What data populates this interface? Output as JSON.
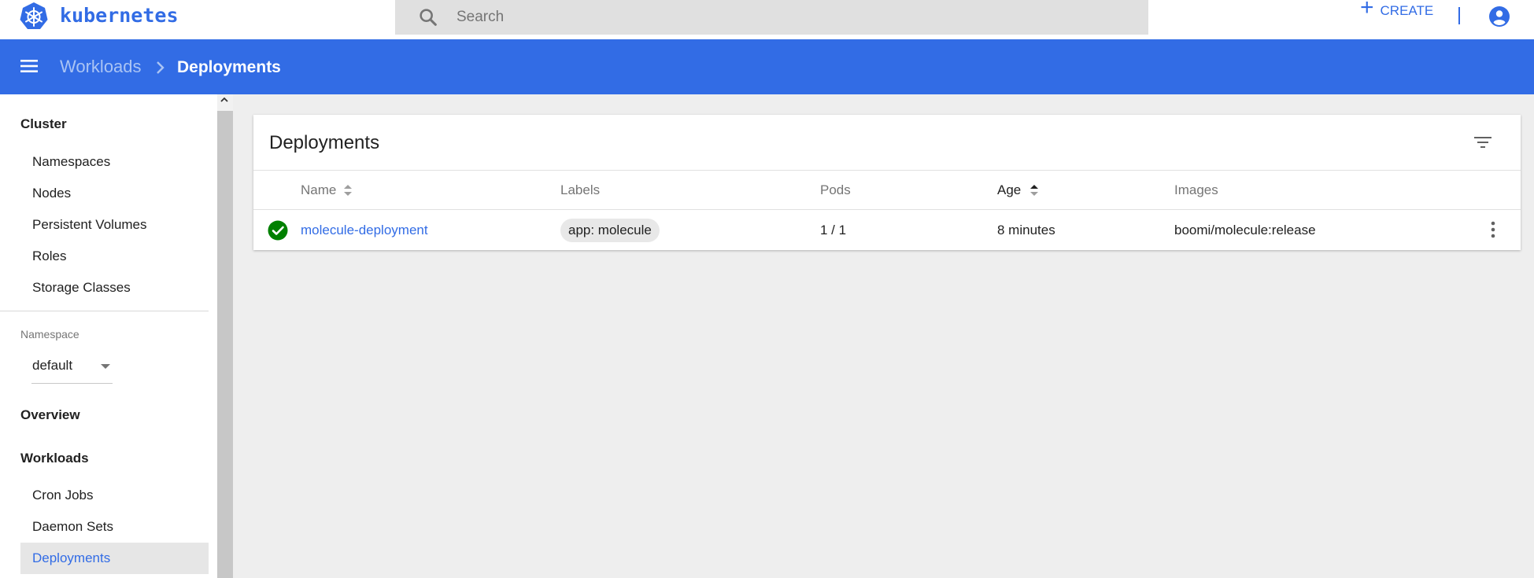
{
  "topbar": {
    "brand": "kubernetes",
    "search_placeholder": "Search",
    "create_label": "CREATE"
  },
  "header": {
    "breadcrumb_parent": "Workloads",
    "breadcrumb_current": "Deployments"
  },
  "sidebar": {
    "cluster_title": "Cluster",
    "cluster_items": [
      "Namespaces",
      "Nodes",
      "Persistent Volumes",
      "Roles",
      "Storage Classes"
    ],
    "namespace_label": "Namespace",
    "namespace_value": "default",
    "overview": "Overview",
    "workloads_title": "Workloads",
    "workload_items": [
      "Cron Jobs",
      "Daemon Sets",
      "Deployments"
    ],
    "active_item": "Deployments"
  },
  "card": {
    "title": "Deployments",
    "columns": [
      "Name",
      "Labels",
      "Pods",
      "Age",
      "Images"
    ],
    "sorted_column": "Age",
    "rows": [
      {
        "status": "running",
        "name": "molecule-deployment",
        "label": "app: molecule",
        "pods": "1 / 1",
        "age": "8 minutes",
        "image": "boomi/molecule:release"
      }
    ]
  },
  "colors": {
    "brand_blue": "#326ce5",
    "status_green": "#008000",
    "background": "#eeeeee"
  },
  "icons": [
    "kubernetes-logo",
    "search-icon",
    "plus-icon",
    "account-circle-icon",
    "menu-icon",
    "chevron-right-icon",
    "filter-icon",
    "sort-icon",
    "check-circle-icon",
    "more-vert-icon",
    "arrow-drop-down-icon",
    "chevron-up-icon"
  ]
}
